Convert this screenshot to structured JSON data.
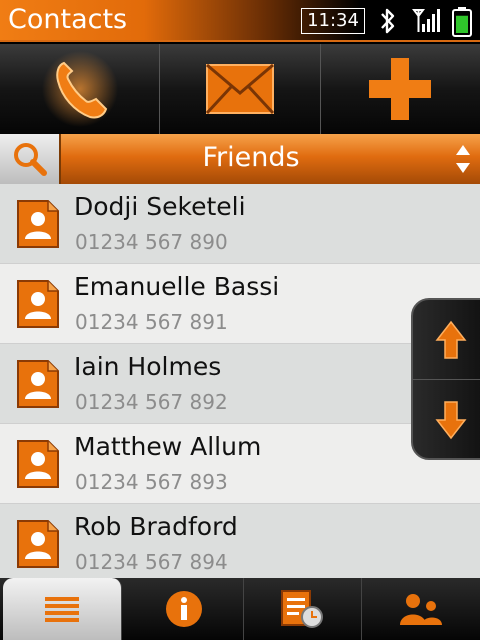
{
  "app": {
    "title": "Contacts"
  },
  "status": {
    "time": "11:34",
    "icons": [
      "bluetooth-icon",
      "signal-icon",
      "battery-icon"
    ],
    "battery_level": 0.75
  },
  "actions": [
    {
      "id": "call",
      "icon": "phone-icon"
    },
    {
      "id": "message",
      "icon": "envelope-icon"
    },
    {
      "id": "add",
      "icon": "plus-icon"
    }
  ],
  "group": {
    "label": "Friends",
    "search_icon": "search-icon",
    "sort_icon": "up-down-arrows-icon"
  },
  "contacts": [
    {
      "name": "Dodji Seketeli",
      "phone": "01234 567 890"
    },
    {
      "name": "Emanuelle Bassi",
      "phone": "01234 567 891"
    },
    {
      "name": "Iain Holmes",
      "phone": "01234 567 892"
    },
    {
      "name": "Matthew Allum",
      "phone": "01234 567 893"
    },
    {
      "name": "Rob Bradford",
      "phone": "01234 567 894"
    }
  ],
  "tabs": [
    {
      "id": "list",
      "icon": "list-icon",
      "active": true
    },
    {
      "id": "info",
      "icon": "info-icon",
      "active": false
    },
    {
      "id": "history",
      "icon": "history-icon",
      "active": false
    },
    {
      "id": "groups",
      "icon": "groups-icon",
      "active": false
    }
  ],
  "colors": {
    "accent": "#e8720c",
    "title_bar": "#f07d14"
  }
}
